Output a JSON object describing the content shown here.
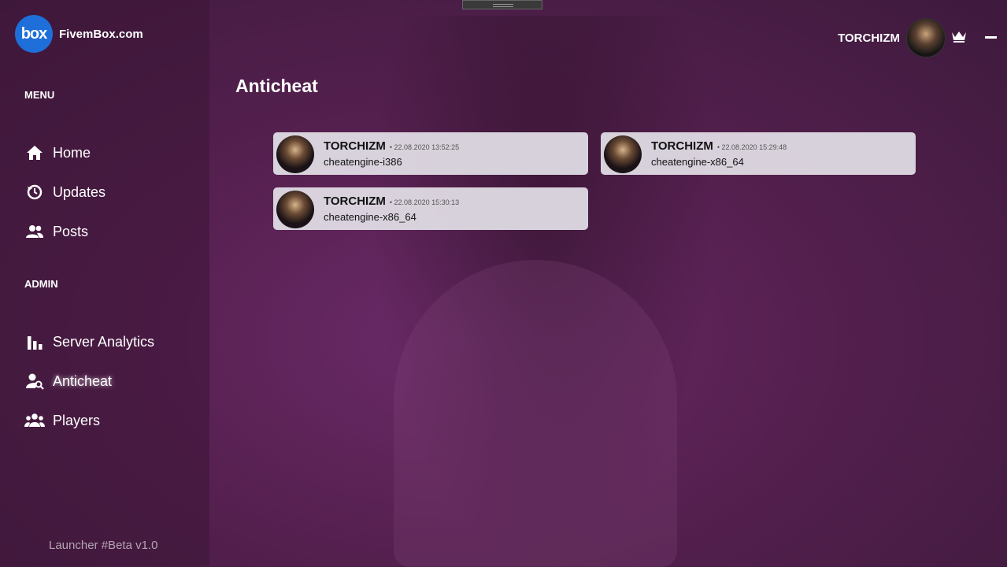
{
  "brand": {
    "logo_text": "box",
    "name": "FivemBox.com"
  },
  "sidebar": {
    "menu_title": "MENU",
    "menu_items": [
      {
        "label": "Home",
        "icon": "home-icon"
      },
      {
        "label": "Updates",
        "icon": "updates-icon"
      },
      {
        "label": "Posts",
        "icon": "users-icon"
      }
    ],
    "admin_title": "ADMIN",
    "admin_items": [
      {
        "label": "Server Analytics",
        "icon": "bar-chart-icon"
      },
      {
        "label": "Anticheat",
        "icon": "user-search-icon",
        "active": true
      },
      {
        "label": "Players",
        "icon": "group-icon"
      }
    ],
    "version": "Launcher #Beta v1.0"
  },
  "topbar": {
    "username": "TORCHIZM",
    "crown_icon": "crown-icon",
    "minimize_icon": "minimize-icon"
  },
  "page": {
    "title": "Anticheat"
  },
  "detections": [
    {
      "user": "TORCHIZM",
      "meta": "• 22.08.2020 13:52:25",
      "text": "cheatengine-i386"
    },
    {
      "user": "TORCHIZM",
      "meta": "• 22.08.2020 15:29:48",
      "text": "cheatengine-x86_64"
    },
    {
      "user": "TORCHIZM",
      "meta": "• 22.08.2020 15:30:13",
      "text": "cheatengine-x86_64"
    }
  ],
  "colors": {
    "brand_blue": "#1e6fd9",
    "background": "#55204f",
    "card": "#ebebf0"
  }
}
